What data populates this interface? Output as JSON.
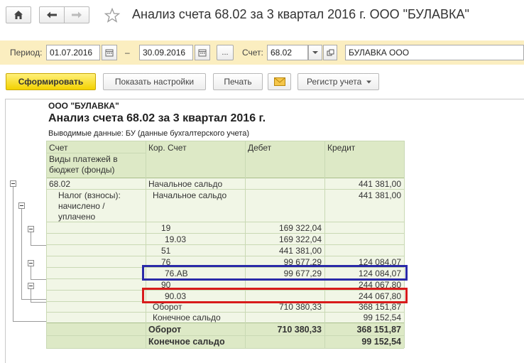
{
  "window": {
    "title": "Анализ счета 68.02 за 3 квартал 2016 г. ООО \"БУЛАВКА\""
  },
  "params": {
    "period_label": "Период:",
    "date_from": "01.07.2016",
    "dash": "–",
    "date_to": "30.09.2016",
    "ellipsis": "...",
    "account_label": "Счет:",
    "account_value": "68.02",
    "org_value": "БУЛАВКА ООО"
  },
  "toolbar": {
    "generate": "Сформировать",
    "settings": "Показать настройки",
    "print": "Печать",
    "register": "Регистр учета"
  },
  "report": {
    "org": "ООО \"БУЛАВКА\"",
    "title": "Анализ счета 68.02 за 3 квартал 2016 г.",
    "output_data": "Выводимые данные:  БУ (данные бухгалтерского учета)",
    "headers": {
      "account": "Счет",
      "payments": "Виды платежей в бюджет (фонды)",
      "kor": "Кор. Счет",
      "debit": "Дебет",
      "credit": "Кредит"
    },
    "rows": [
      {
        "a": "68.02",
        "k": "Начальное сальдо",
        "d": "",
        "c": "441 381,00"
      },
      {
        "a": "Налог (взносы): начислено / уплачено",
        "k": "Начальное сальдо",
        "d": "",
        "c": "441 381,00"
      },
      {
        "a": "",
        "k": "19",
        "d": "169 322,04",
        "c": ""
      },
      {
        "a": "",
        "k": "19.03",
        "d": "169 322,04",
        "c": ""
      },
      {
        "a": "",
        "k": "51",
        "d": "441 381,00",
        "c": ""
      },
      {
        "a": "",
        "k": "76",
        "d": "99 677,29",
        "c": "124 084,07"
      },
      {
        "a": "",
        "k": "76.АВ",
        "d": "99 677,29",
        "c": "124 084,07"
      },
      {
        "a": "",
        "k": "90",
        "d": "",
        "c": "244 067,80"
      },
      {
        "a": "",
        "k": "90.03",
        "d": "",
        "c": "244 067,80"
      },
      {
        "a": "",
        "k": "Оборот",
        "d": "710 380,33",
        "c": "368 151,87"
      },
      {
        "a": "",
        "k": "Конечное сальдо",
        "d": "",
        "c": "99 152,54"
      },
      {
        "a": "",
        "k": "Оборот",
        "d": "710 380,33",
        "c": "368 151,87"
      },
      {
        "a": "",
        "k": "Конечное сальдо",
        "d": "",
        "c": "99 152,54"
      }
    ]
  },
  "colors": {
    "header_bg": "#dde9c6",
    "row_bg": "#f1f6e6",
    "params_bg": "#fbeec0",
    "primary_btn": "#f3d200",
    "highlight_blue": "#2a2aa8",
    "highlight_red": "#d81b1b"
  },
  "icons": {
    "home": "home-icon",
    "back": "arrow-left-icon",
    "forward": "arrow-right-icon",
    "favorite": "star-icon",
    "calendar": "calendar-icon",
    "dropdown": "chevron-down-icon",
    "open": "open-icon",
    "mail": "envelope-icon",
    "expand": "minus-box-icon"
  }
}
